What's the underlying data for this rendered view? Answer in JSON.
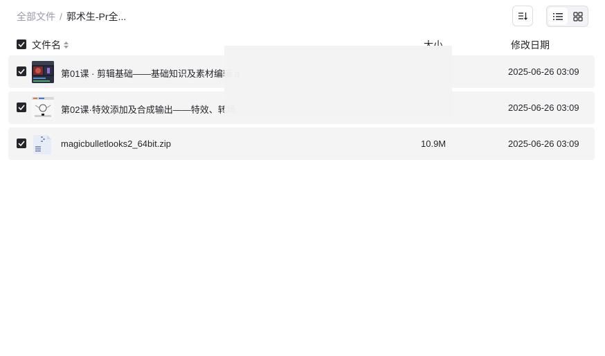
{
  "breadcrumb": {
    "root": "全部文件",
    "separator": "/",
    "current": "郭术生-Pr全..."
  },
  "toolbar": {
    "sort_icon": "sort-icon",
    "list_view_icon": "list-view-icon",
    "grid_view_icon": "grid-view-icon"
  },
  "table": {
    "headers": {
      "name": "文件名",
      "size": "大小",
      "modified": "修改日期"
    },
    "rows": [
      {
        "name": "第01课 · 剪辑基础——基础知识及素材编辑.a",
        "size": "",
        "modified": "2025-06-26 03:09",
        "checked": true,
        "thumb": "video-thumbnail"
      },
      {
        "name": "第02课·特效添加及合成输出——特效、转场",
        "size": "",
        "modified": "2025-06-26 03:09",
        "checked": true,
        "thumb": "video-thumbnail"
      },
      {
        "name": "magicbulletlooks2_64bit.zip",
        "size": "10.9M",
        "modified": "2025-06-26 03:09",
        "checked": true,
        "thumb": "zip-file-icon"
      }
    ]
  },
  "colors": {
    "row_bg": "#f4f4f5",
    "checkbox": "#25262b",
    "muted_text": "#999aaa"
  }
}
